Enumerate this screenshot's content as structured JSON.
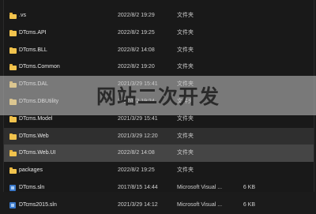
{
  "files": [
    {
      "kind": "folder",
      "icon": "folder-icon",
      "name": ".vs",
      "date": "2022/8/2 19:29",
      "type": "文件夹",
      "size": ""
    },
    {
      "kind": "folder",
      "icon": "folder-icon",
      "name": "DTcms.API",
      "date": "2022/8/2 19:25",
      "type": "文件夹",
      "size": ""
    },
    {
      "kind": "folder",
      "icon": "folder-icon",
      "name": "DTcms.BLL",
      "date": "2022/8/2 14:08",
      "type": "文件夹",
      "size": ""
    },
    {
      "kind": "folder",
      "icon": "folder-icon",
      "name": "DTcms.Common",
      "date": "2022/8/2 19:20",
      "type": "文件夹",
      "size": ""
    },
    {
      "kind": "folder",
      "icon": "folder-icon",
      "name": "DTcms.DAL",
      "date": "2021/3/29 15:41",
      "type": "文件夹",
      "size": ""
    },
    {
      "kind": "folder",
      "icon": "folder-icon",
      "name": "DTcms.DBUtility",
      "date": "2022/8/2 19:24",
      "type": "文件夹",
      "size": ""
    },
    {
      "kind": "folder",
      "icon": "folder-icon",
      "name": "DTcms.Model",
      "date": "2021/3/29 15:41",
      "type": "文件夹",
      "size": ""
    },
    {
      "kind": "folder",
      "icon": "folder-icon",
      "name": "DTcms.Web",
      "date": "2021/3/29 12:20",
      "type": "文件夹",
      "size": ""
    },
    {
      "kind": "folder",
      "icon": "folder-icon",
      "name": "DTcms.Web.UI",
      "date": "2022/8/2 14:08",
      "type": "文件夹",
      "size": ""
    },
    {
      "kind": "folder",
      "icon": "folder-icon",
      "name": "packages",
      "date": "2022/8/2 19:25",
      "type": "文件夹",
      "size": ""
    },
    {
      "kind": "file",
      "icon": "sln-file-icon",
      "name": "DTcms.sln",
      "date": "2017/8/15 14:44",
      "type": "Microsoft Visual ...",
      "size": "6 KB"
    },
    {
      "kind": "file",
      "icon": "sln-file-icon",
      "name": "DTcms2015.sln",
      "date": "2021/3/29 14:12",
      "type": "Microsoft Visual ...",
      "size": "6 KB"
    }
  ],
  "banner": {
    "text": "网站二次开发"
  },
  "colors": {
    "background": "#191919",
    "folder": "#f1c34d",
    "selected_row": "#454545",
    "banner": "#c8c8c8"
  }
}
